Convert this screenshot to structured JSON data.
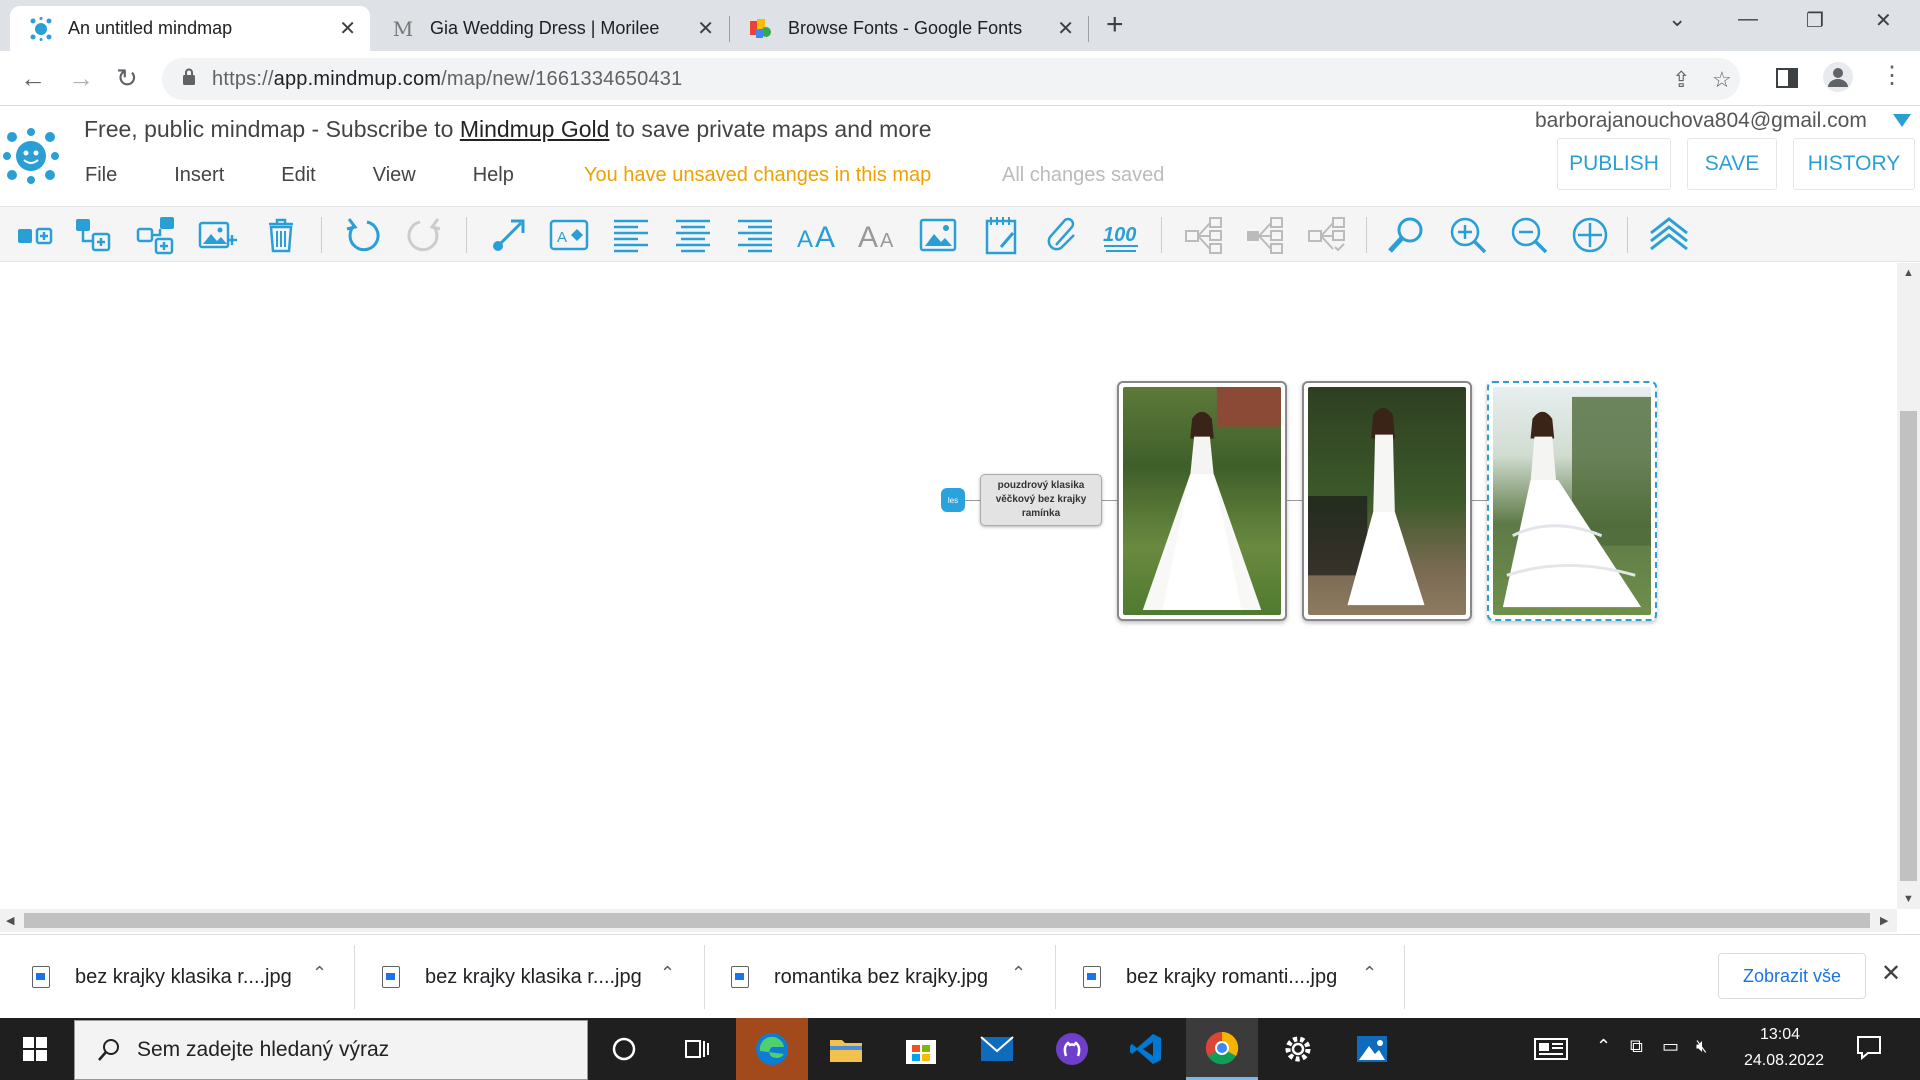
{
  "browser": {
    "tabs": [
      {
        "title": "An untitled mindmap",
        "active": true
      },
      {
        "title": "Gia Wedding Dress | Morilee",
        "active": false
      },
      {
        "title": "Browse Fonts - Google Fonts",
        "active": false
      }
    ],
    "url_prefix": "https://",
    "url_host": "app.mindmup.com",
    "url_path": "/map/new/1661334650431"
  },
  "mindmup": {
    "banner_before": "Free, public mindmap - Subscribe to ",
    "banner_link": "Mindmup Gold",
    "banner_after": " to save private maps and more",
    "menu": [
      "File",
      "Insert",
      "Edit",
      "View",
      "Help"
    ],
    "unsaved_notice": "You have unsaved changes in this map",
    "saved_status": "All changes saved",
    "user_email": "barborajanouchova804@gmail.com",
    "buttons": {
      "publish": "PUBLISH",
      "save": "SAVE",
      "history": "HISTORY"
    },
    "accent_color": "#2a9fd6",
    "toolbar_icons": [
      "add-child-icon",
      "add-sibling-icon",
      "add-parent-icon",
      "insert-image-icon",
      "delete-icon",
      "undo-icon",
      "redo-icon",
      "connect-icon",
      "node-style-icon",
      "align-left-icon",
      "align-center-icon",
      "align-right-icon",
      "font-bigger-icon",
      "font-smaller-icon",
      "image-node-icon",
      "note-icon",
      "link-icon",
      "progress-icon",
      "expand-icon",
      "collapse-icon",
      "toggle-icon",
      "search-icon",
      "zoom-in-icon",
      "zoom-out-icon",
      "reset-view-icon",
      "collapse-toolbar-icon"
    ]
  },
  "map": {
    "root_label": "les",
    "text_node": "pouzdrový klasika věčkový bez krajky ramínka"
  },
  "downloads": {
    "items": [
      "bez krajky klasika r....jpg",
      "bez krajky klasika r....jpg",
      "romantika bez krajky.jpg",
      "bez krajky romanti....jpg"
    ],
    "show_all": "Zobrazit vše"
  },
  "taskbar": {
    "search_placeholder": "Sem zadejte hledaný výraz",
    "time": "13:04",
    "date": "24.08.2022"
  }
}
